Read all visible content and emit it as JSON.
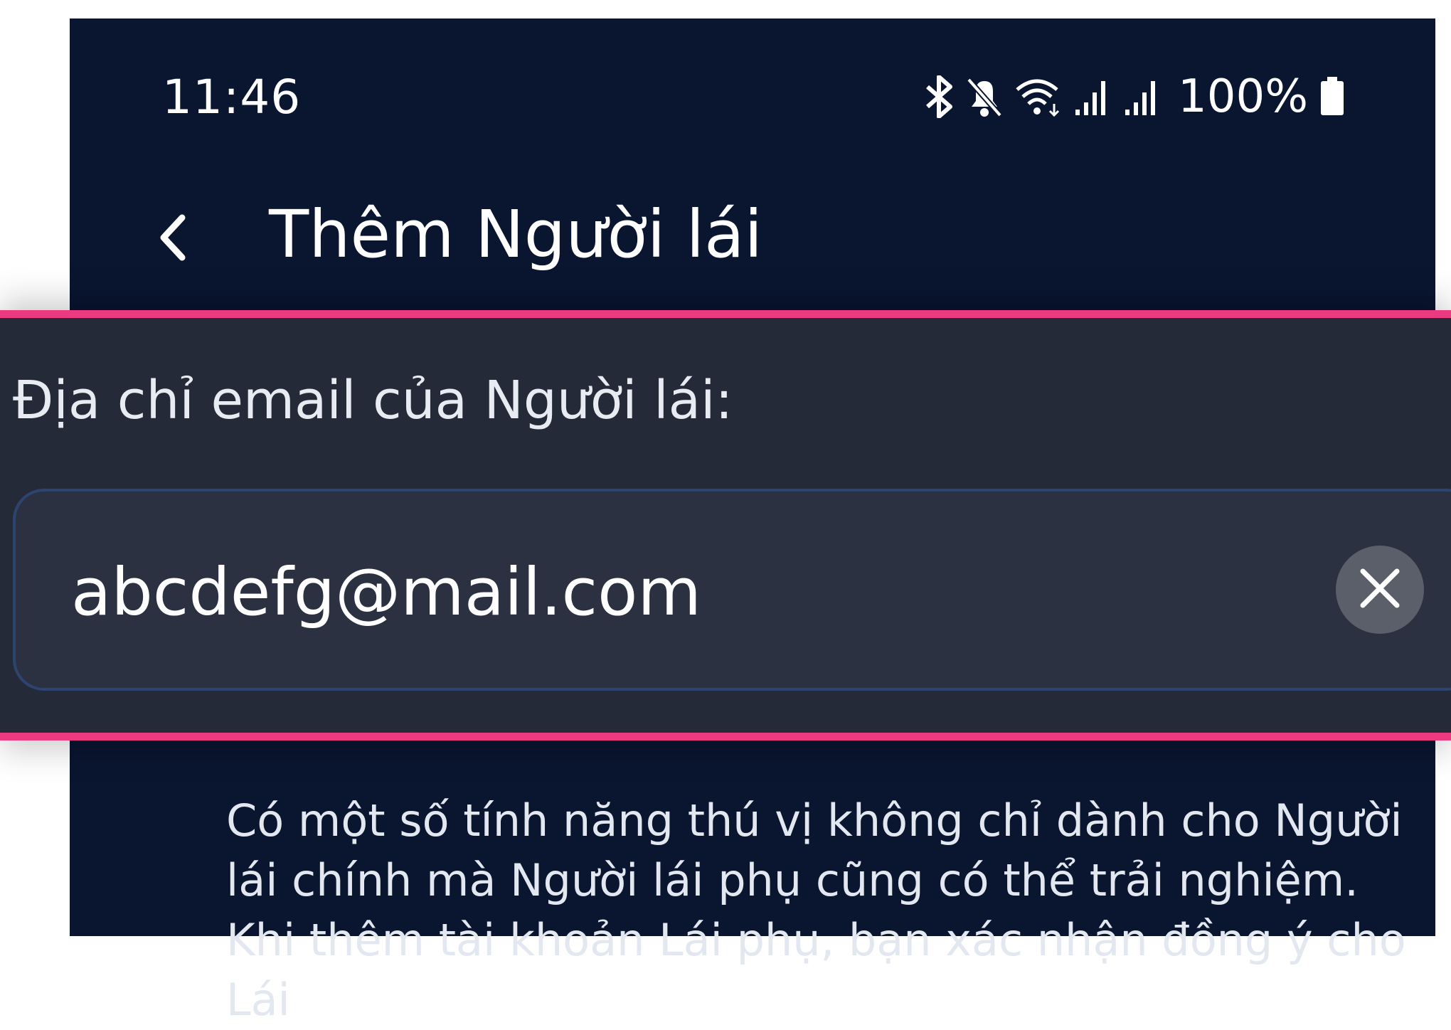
{
  "status_bar": {
    "time": "11:46",
    "battery": "100%",
    "icons": [
      "bluetooth-icon",
      "mute-icon",
      "wifi-icon",
      "signal-icon",
      "signal-icon",
      "battery-icon"
    ]
  },
  "app_bar": {
    "back_icon": "chevron-left-icon",
    "title": "Thêm Người lái"
  },
  "form": {
    "email_label": "Địa chỉ email của Người lái:",
    "email_value": "abcdefg@mail.com",
    "clear_icon": "close-icon"
  },
  "description": "Có một số tính năng thú vị không chỉ dành cho Người lái chính mà Người lái phụ cũng có thể trải nghiệm. Khi thêm tài khoản Lái phụ, bạn xác nhận đồng ý cho Lái",
  "colors": {
    "background": "#0a1530",
    "panel": "#242a38",
    "highlight_border": "#ec3a80",
    "field_border": "#2e4470"
  }
}
